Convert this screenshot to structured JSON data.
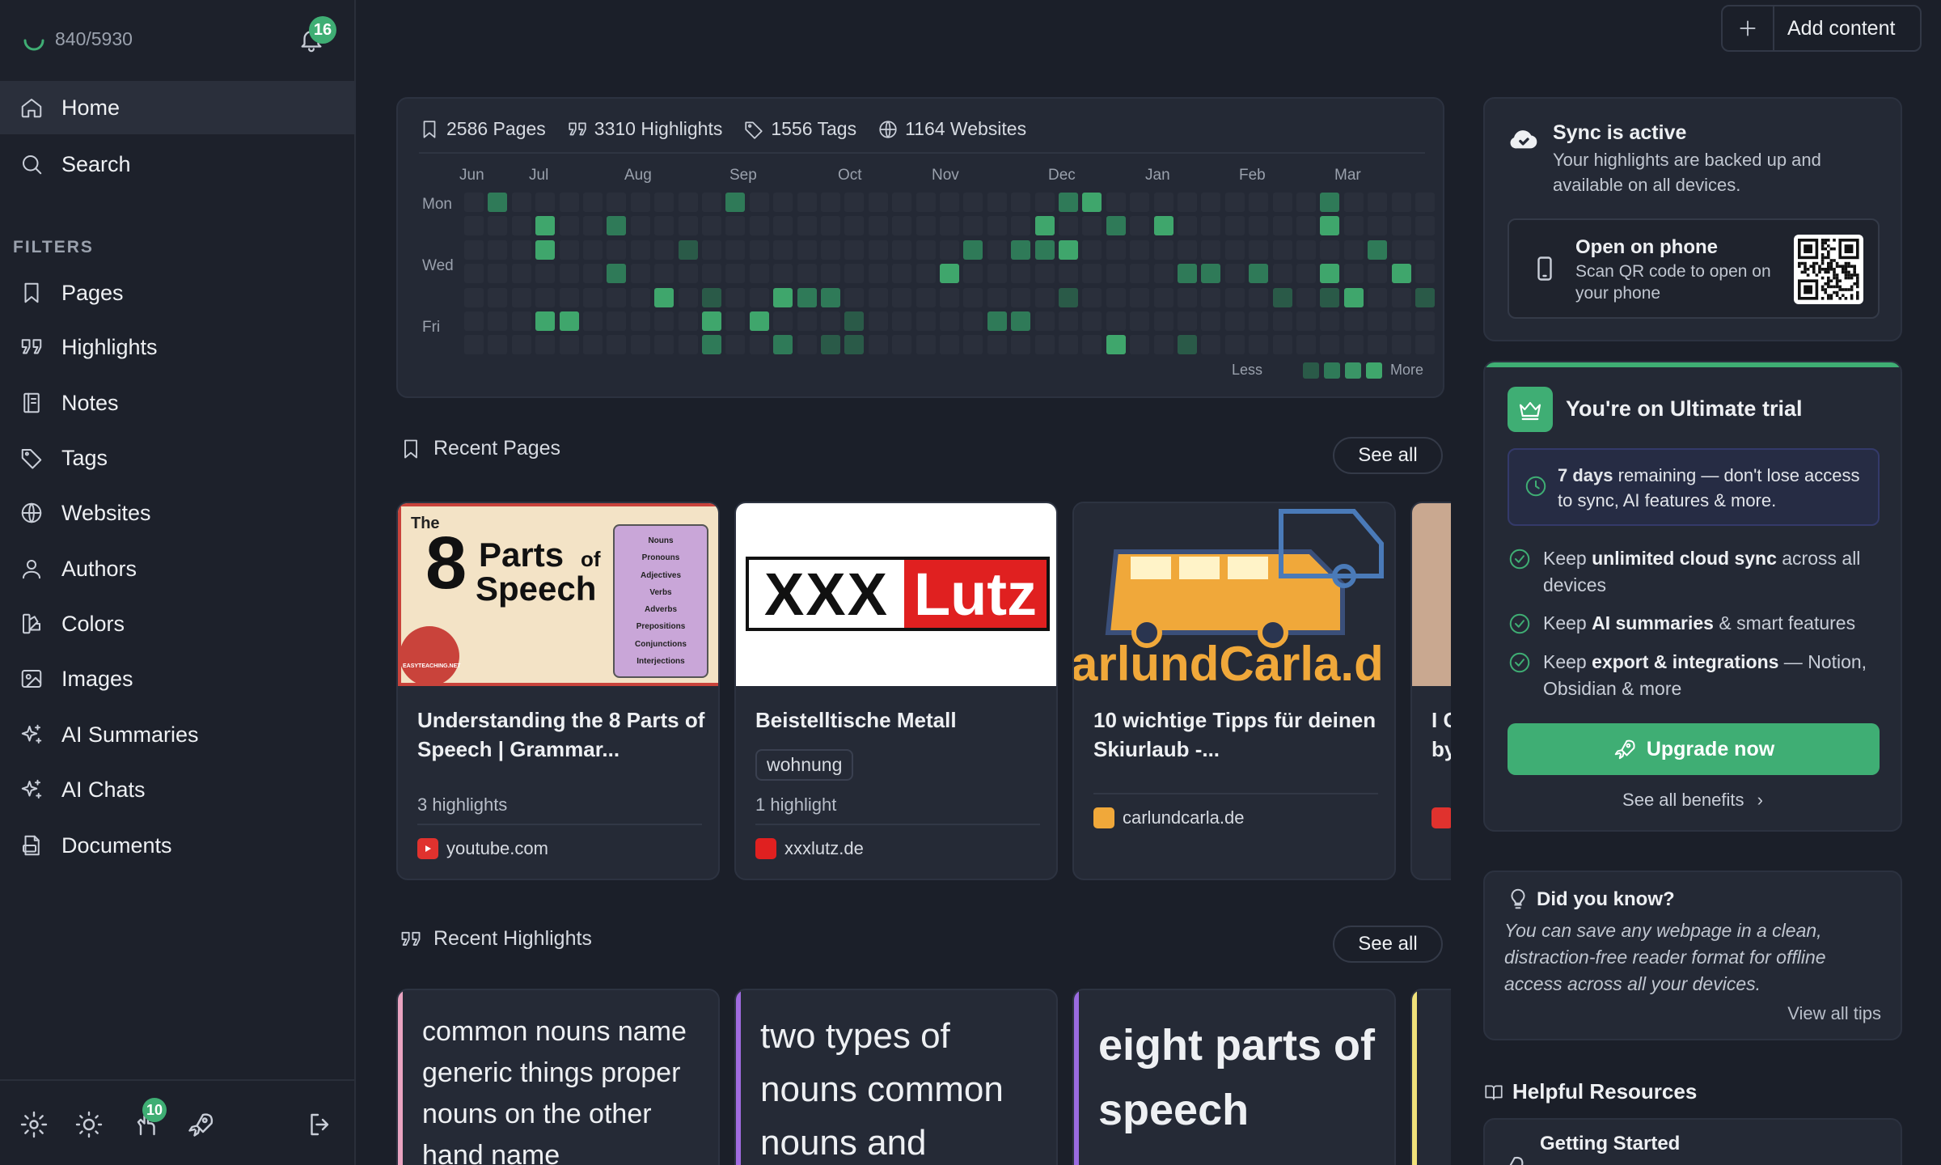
{
  "sidebar": {
    "sync_count": "840/5930",
    "notification_count": "16",
    "nav": [
      {
        "label": "Home",
        "icon": "home-icon",
        "active": true
      },
      {
        "label": "Search",
        "icon": "search-icon",
        "active": false
      }
    ],
    "filters_label": "FILTERS",
    "filters": [
      {
        "label": "Pages",
        "icon": "bookmark-icon"
      },
      {
        "label": "Highlights",
        "icon": "quote-icon"
      },
      {
        "label": "Notes",
        "icon": "notebook-icon"
      },
      {
        "label": "Tags",
        "icon": "tag-icon"
      },
      {
        "label": "Websites",
        "icon": "globe-icon"
      },
      {
        "label": "Authors",
        "icon": "user-icon"
      },
      {
        "label": "Colors",
        "icon": "palette-icon"
      },
      {
        "label": "Images",
        "icon": "image-icon"
      },
      {
        "label": "AI Summaries",
        "icon": "sparkles-icon"
      },
      {
        "label": "AI Chats",
        "icon": "sparkles-icon"
      },
      {
        "label": "Documents",
        "icon": "pdf-icon"
      }
    ],
    "bottom_badge": "10"
  },
  "topbar": {
    "add_label": "Add content"
  },
  "stats": {
    "pages": "2586 Pages",
    "highlights": "3310 Highlights",
    "tags": "1556 Tags",
    "websites": "1164 Websites"
  },
  "heatmap": {
    "months": [
      "Jun",
      "Jul",
      "Aug",
      "Sep",
      "Oct",
      "Nov",
      "Dec",
      "Jan",
      "Feb",
      "Mar"
    ],
    "days": [
      "Mon",
      "Wed",
      "Fri"
    ],
    "legend_less": "Less",
    "legend_more": "More",
    "colors": [
      "#2a2f3b",
      "#2a5a48",
      "#2f7a58",
      "#3fa66c"
    ]
  },
  "recent_pages": {
    "title": "Recent Pages",
    "see_all": "See all",
    "cards": [
      {
        "title": "Understanding the 8 Parts of Speech | Grammar...",
        "highlights": "3 highlights",
        "site": "youtube.com",
        "thumb": {
          "the": "The",
          "eight": "8",
          "parts": "Parts",
          "of": "of",
          "speech": "Speech",
          "list": [
            "Nouns",
            "Pronouns",
            "Adjectives",
            "Verbs",
            "Adverbs",
            "Prepositions",
            "Conjunctions",
            "Interjections"
          ],
          "badge": "EASYTEACHING.NET"
        }
      },
      {
        "title": "Beistelltische Metall",
        "tag": "wohnung",
        "highlights": "1 highlight",
        "site": "xxxlutz.de",
        "thumb": {
          "left": "XXX",
          "right": "Lutz"
        }
      },
      {
        "title": "10 wichtige Tipps für deinen Skiurlaub -...",
        "site": "carlundcarla.de",
        "thumb": {
          "wordmark": "arlundCarla.d"
        }
      },
      {
        "title": "I C by"
      }
    ]
  },
  "recent_highlights": {
    "title": "Recent Highlights",
    "see_all": "See all",
    "cards": [
      {
        "text": "common nouns name generic things proper nouns on the other hand name",
        "color": "#e9a3c0"
      },
      {
        "text": "two types of nouns common nouns and",
        "color": "#a06be0"
      },
      {
        "text": "eight parts of speech",
        "color": "#9a6be0"
      },
      {
        "text": "",
        "color": "#f2e27a"
      }
    ]
  },
  "sync": {
    "title": "Sync is active",
    "desc": "Your highlights are backed up and available on all devices.",
    "phone_title": "Open on phone",
    "phone_desc": "Scan QR code to open on your phone"
  },
  "trial": {
    "title": "You're on Ultimate trial",
    "days_bold": "7 days",
    "days_rest": " remaining — don't lose access to sync, AI features & more.",
    "benefits": [
      {
        "pre": "Keep ",
        "bold": "unlimited cloud sync",
        "post": " across all devices"
      },
      {
        "pre": "Keep ",
        "bold": "AI summaries",
        "post": " & smart features"
      },
      {
        "pre": "Keep ",
        "bold": "export & integrations",
        "post": " — Notion, Obsidian & more"
      }
    ],
    "upgrade_label": "Upgrade now",
    "benefits_link": "See all benefits"
  },
  "tip": {
    "title": "Did you know?",
    "text": "You can save any webpage in a clean, distraction-free reader format for offline access across all your devices.",
    "link": "View all tips"
  },
  "resources": {
    "title": "Helpful Resources",
    "first_item": "Getting Started"
  },
  "colors": {
    "accent": "#3fae74",
    "background": "#1b1f29",
    "card": "#242935"
  }
}
